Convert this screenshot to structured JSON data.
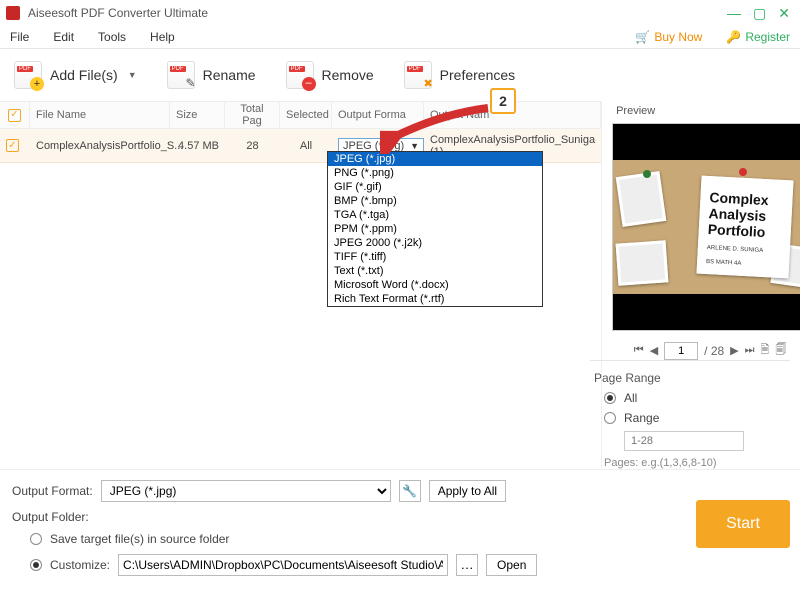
{
  "window": {
    "title": "Aiseesoft PDF Converter Ultimate"
  },
  "menu": {
    "file": "File",
    "edit": "Edit",
    "tools": "Tools",
    "help": "Help",
    "buy": "Buy Now",
    "register": "Register"
  },
  "toolbar": {
    "add": "Add File(s)",
    "rename": "Rename",
    "remove": "Remove",
    "pref": "Preferences"
  },
  "table": {
    "headers": {
      "name": "File Name",
      "size": "Size",
      "pages": "Total Pag",
      "selected": "Selected",
      "format": "Output Forma",
      "outname": "Output Nam"
    },
    "rows": [
      {
        "name": "ComplexAnalysisPortfolio_S...",
        "size": "4.57 MB",
        "pages": "28",
        "selected": "All",
        "format": "JPEG (*.jpg)",
        "outname": "ComplexAnalysisPortfolio_Suniga (1)"
      }
    ]
  },
  "dropdown": {
    "options": [
      "JPEG (*.jpg)",
      "PNG (*.png)",
      "GIF (*.gif)",
      "BMP (*.bmp)",
      "TGA (*.tga)",
      "PPM (*.ppm)",
      "JPEG 2000 (*.j2k)",
      "TIFF (*.tiff)",
      "Text (*.txt)",
      "Microsoft Word (*.docx)",
      "Rich Text Format (*.rtf)"
    ],
    "selected": "JPEG (*.jpg)"
  },
  "preview": {
    "label": "Preview",
    "title_l1": "Complex",
    "title_l2": "Analysis",
    "title_l3": "Portfolio",
    "sub1": "ARLENE D. SUNIGA",
    "sub2": "BS MATH 4A",
    "page_current": "1",
    "page_total": "/ 28"
  },
  "bottom": {
    "output_format_label": "Output Format:",
    "output_format_value": "JPEG (*.jpg)",
    "apply_all": "Apply to All",
    "output_folder_label": "Output Folder:",
    "save_source": "Save target file(s) in source folder",
    "customize": "Customize:",
    "path": "C:\\Users\\ADMIN\\Dropbox\\PC\\Documents\\Aiseesoft Studio\\Aiseesoft P",
    "open": "Open",
    "start": "Start"
  },
  "page_range": {
    "header": "Page Range",
    "all": "All",
    "range": "Range",
    "placeholder": "1-28",
    "hint": "Pages: e.g.(1,3,6,8-10)"
  },
  "annotation": {
    "step": "2"
  }
}
